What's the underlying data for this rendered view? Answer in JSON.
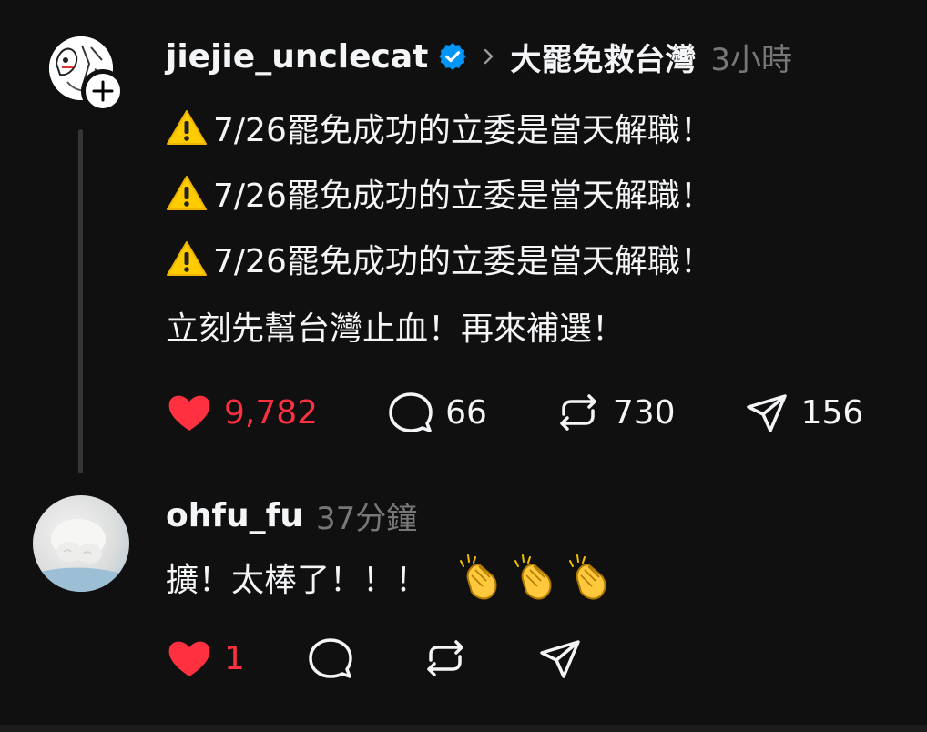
{
  "post": {
    "username": "jiejie_unclecat",
    "topic": "大罷免救台灣",
    "time": "3小時",
    "lines": [
      "7/26罷免成功的立委是當天解職！",
      "7/26罷免成功的立委是當天解職！",
      "7/26罷免成功的立委是當天解職！"
    ],
    "second_paragraph": "立刻先幫台灣止血！再來補選！",
    "likes": "9,782",
    "comments": "66",
    "reposts": "730",
    "shares": "156",
    "icons": {
      "warning": "warning-icon",
      "verified": "verified-badge-icon",
      "chevron": "chevron-right-icon",
      "like": "heart-icon",
      "comment": "comment-icon",
      "repost": "repost-icon",
      "share": "send-icon",
      "follow": "plus-icon"
    },
    "colors": {
      "like_red": "#ff3040",
      "verified_blue": "#0095f6"
    }
  },
  "reply": {
    "username": "ohfu_fu",
    "time": "37分鐘",
    "text": "擴！太棒了！！！",
    "emoji": [
      "clapping-hands-icon",
      "clapping-hands-icon",
      "clapping-hands-icon"
    ],
    "likes": "1"
  }
}
